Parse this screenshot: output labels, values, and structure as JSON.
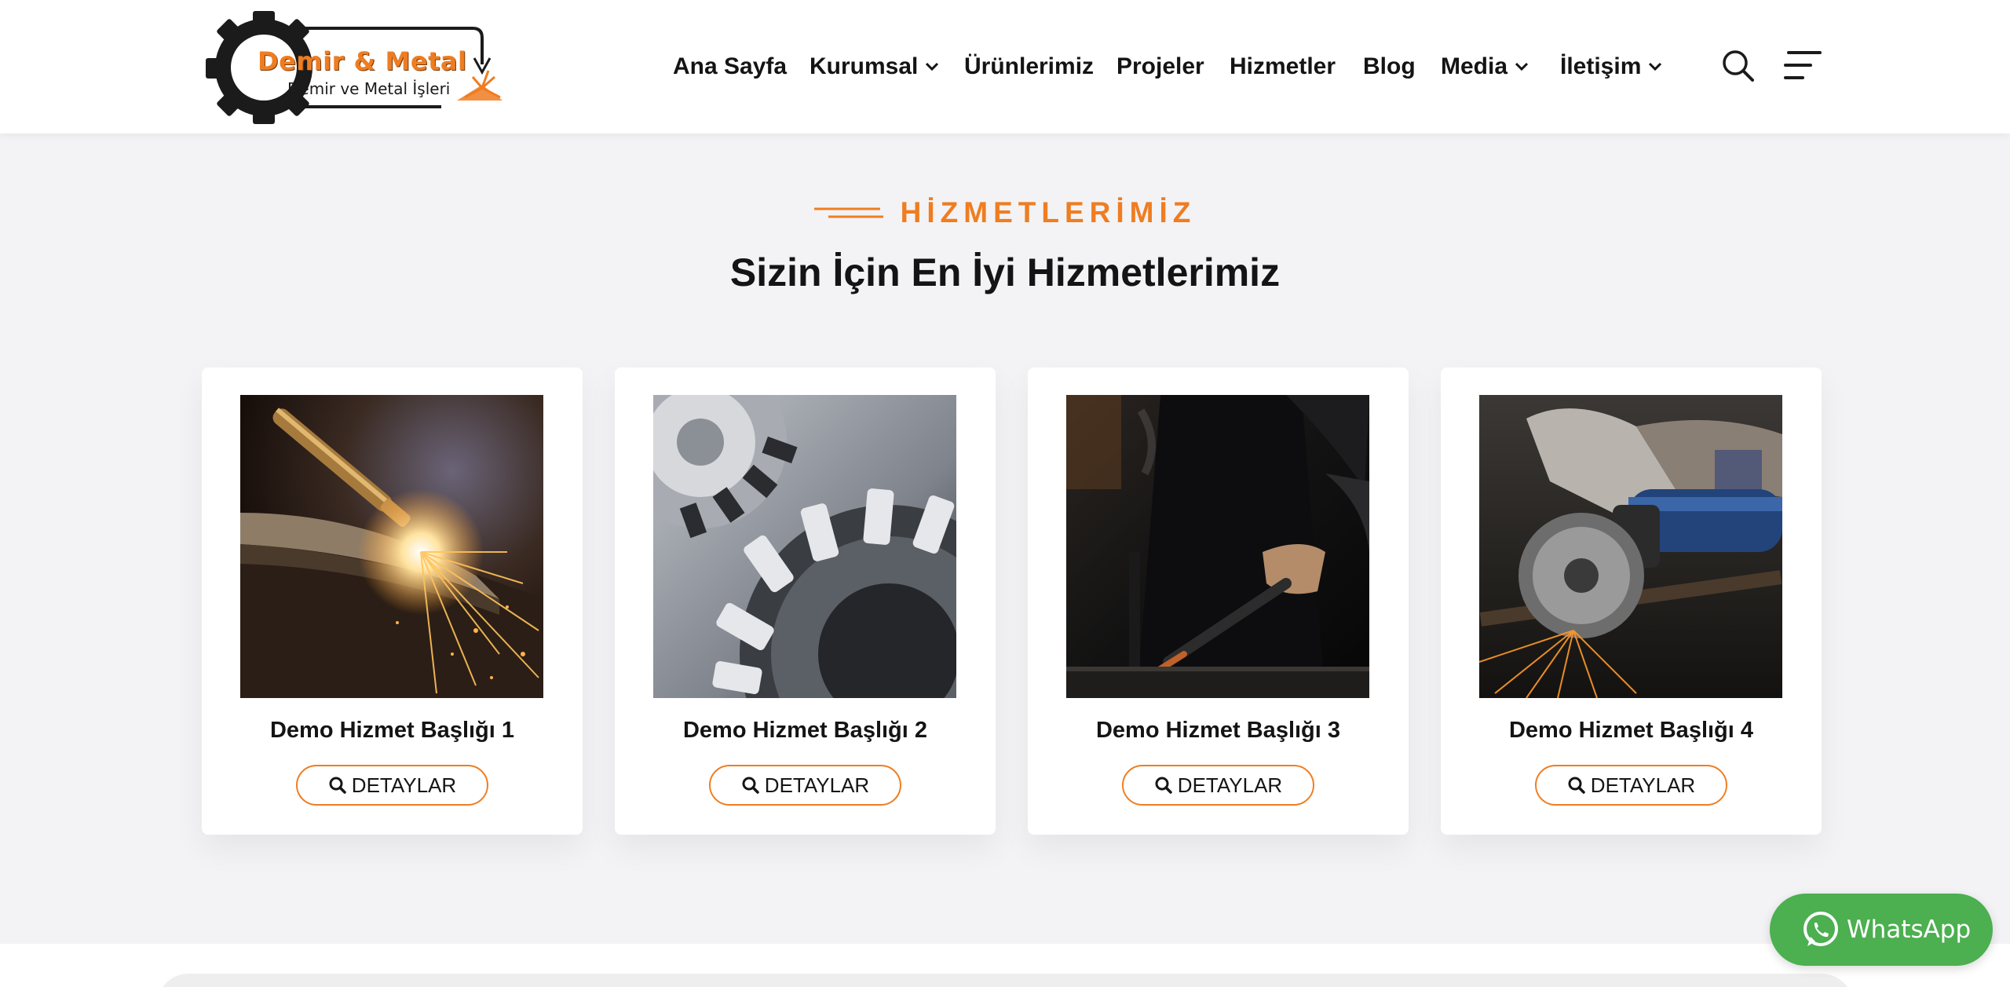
{
  "logo": {
    "title": "Demir & Metal",
    "subtitle": "Demir ve Metal İşleri"
  },
  "nav": {
    "items": [
      {
        "label": "Ana Sayfa",
        "has_dropdown": false
      },
      {
        "label": "Kurumsal",
        "has_dropdown": true
      },
      {
        "label": "Ürünlerimiz",
        "has_dropdown": false
      },
      {
        "label": "Projeler",
        "has_dropdown": false
      },
      {
        "label": "Hizmetler",
        "has_dropdown": false
      },
      {
        "label": "Blog",
        "has_dropdown": false
      },
      {
        "label": "Media",
        "has_dropdown": true
      },
      {
        "label": "İletişim",
        "has_dropdown": true
      }
    ],
    "search_icon": "search-icon",
    "menu_icon": "hamburger-menu-icon"
  },
  "section": {
    "eyebrow": "HİZMETLERİMİZ",
    "title": "Sizin İçin En İyi Hizmetlerimiz"
  },
  "services": [
    {
      "title": "Demo Hizmet Başlığı 1",
      "button_label": "DETAYLAR",
      "image": "welding-torch-sparks"
    },
    {
      "title": "Demo Hizmet Başlığı 2",
      "button_label": "DETAYLAR",
      "image": "metal-gears"
    },
    {
      "title": "Demo Hizmet Başlığı 3",
      "button_label": "DETAYLAR",
      "image": "blacksmith-forging"
    },
    {
      "title": "Demo Hizmet Başlığı 4",
      "button_label": "DETAYLAR",
      "image": "angle-grinder-sparks"
    }
  ],
  "whatsapp": {
    "label": "WhatsApp"
  },
  "colors": {
    "accent": "#ef7d21",
    "heading": "#141414",
    "background": "#f3f3f5",
    "whatsapp": "#4caf50"
  }
}
